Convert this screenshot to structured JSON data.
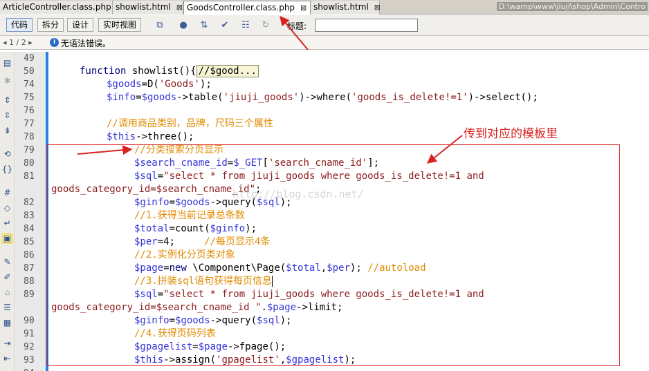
{
  "tabs": [
    {
      "label": "ArticleController.class.php",
      "close": "⊠"
    },
    {
      "label": "showlist.html",
      "close": "⊠"
    },
    {
      "label": "GoodsController.class.php",
      "close": "⊠"
    },
    {
      "label": "showlist.html",
      "close": "⊠"
    }
  ],
  "path": "D:\\wamp\\www\\jiuji\\shop\\Admin\\Contro",
  "toolbar": {
    "code_label": "代码",
    "split_label": "拆分",
    "design_label": "设计",
    "live_label": "实时视图",
    "title_label": "标题:",
    "title_value": ""
  },
  "errbar": {
    "page": "1 / 2",
    "message": "无语法错误。"
  },
  "annotation": {
    "text": "传到对应的模板里",
    "watermark": "http://blog.csdn.net/"
  },
  "colors": {
    "accent_blue": "#2b7fe0",
    "annotation_red": "#d9211f"
  },
  "lines": [
    {
      "n": "49"
    },
    {
      "n": "50"
    },
    {
      "n": "74"
    },
    {
      "n": "75"
    },
    {
      "n": "76"
    },
    {
      "n": "77"
    },
    {
      "n": "78"
    },
    {
      "n": "79"
    },
    {
      "n": "80"
    },
    {
      "n": "81"
    },
    {
      "n": ""
    },
    {
      "n": "82"
    },
    {
      "n": "83"
    },
    {
      "n": "84"
    },
    {
      "n": "85"
    },
    {
      "n": "86"
    },
    {
      "n": "87"
    },
    {
      "n": "88"
    },
    {
      "n": "89"
    },
    {
      "n": ""
    },
    {
      "n": "90"
    },
    {
      "n": "91"
    },
    {
      "n": "92"
    },
    {
      "n": "93"
    },
    {
      "n": "94"
    }
  ],
  "code": {
    "l50_kw": "function",
    "l50_fn": " showlist(){",
    "l50_fold": "//$good...",
    "l74_v": "$goods",
    "l74_a": "=D(",
    "l74_s": "'Goods'",
    "l74_b": ");",
    "l75_v": "$info",
    "l75_a": "=",
    "l75_v2": "$goods",
    "l75_b": "->table(",
    "l75_s": "'jiuji_goods'",
    "l75_c": ")->where(",
    "l75_s2": "'goods_is_delete!=1'",
    "l75_d": ")->select();",
    "l77_c": "//调用商品类别，品牌，尺码三个属性",
    "l78_v": "$this",
    "l78_a": "->three();",
    "l79_c": "//分类搜索分页显示",
    "l80_v": "$search_cname_id",
    "l80_a": "=",
    "l80_v2": "$_GET",
    "l80_b": "[",
    "l80_s": "'search_cname_id'",
    "l80_c": "];",
    "l81_v": "$sql",
    "l81_a": "=",
    "l81_s": "\"select * from jiuji_goods where goods_is_delete!=1 and",
    "l81b_s": "goods_category_id=$search_cname_id\"",
    "l81b_a": ";",
    "l82_v": "$ginfo",
    "l82_a": "=",
    "l82_v2": "$goods",
    "l82_b": "->query(",
    "l82_v3": "$sql",
    "l82_c": ");",
    "l83_c": "//1.获得当前记录总条数",
    "l84_v": "$total",
    "l84_a": "=count(",
    "l84_v2": "$ginfo",
    "l84_b": ");",
    "l85_v": "$per",
    "l85_a": "=4;     ",
    "l85_c": "//每页显示4条",
    "l86_c": "//2.实例化分页类对象",
    "l87_v": "$page",
    "l87_a": "=",
    "l87_kw": "new",
    "l87_b": " \\Component\\Page(",
    "l87_v2": "$total",
    "l87_c": ",",
    "l87_v3": "$per",
    "l87_d": "); ",
    "l87_cm": "//autoload",
    "l88_c": "//3.拼装sql语句获得每页信息",
    "l89_v": "$sql",
    "l89_a": "=",
    "l89_s": "\"select * from jiuji_goods where goods_is_delete!=1 and",
    "l89b_s": "goods_category_id=$search_cname_id \"",
    "l89b_a": ".",
    "l89b_v": "$page",
    "l89b_b": "->limit;",
    "l90_v": "$ginfo",
    "l90_a": "=",
    "l90_v2": "$goods",
    "l90_b": "->query(",
    "l90_v3": "$sql",
    "l90_c": ");",
    "l91_c": "//4.获得页码列表",
    "l92_v": "$gpagelist",
    "l92_a": "=",
    "l92_v2": "$page",
    "l92_b": "->fpage();",
    "l93_v": "$this",
    "l93_a": "->assign(",
    "l93_s": "'gpagelist'",
    "l93_b": ",",
    "l93_v2": "$gpagelist",
    "l93_c": ");"
  }
}
